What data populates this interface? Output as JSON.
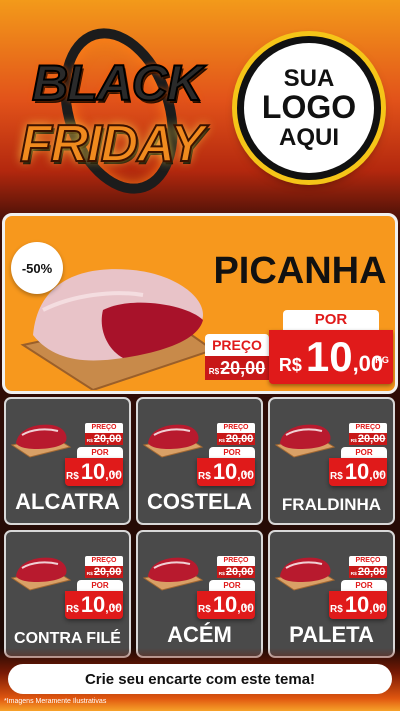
{
  "header": {
    "brand_line1": "BLACK",
    "brand_line2": "FRIDAY",
    "logo_placeholder": [
      "SUA",
      "LOGO",
      "AQUI"
    ]
  },
  "hero": {
    "discount": "-50%",
    "product": "PICANHA",
    "preco_label": "PREÇO",
    "old_currency": "R$",
    "old_price": "20,00",
    "por_label": "POR",
    "new_currency": "R$",
    "new_int": "10",
    "new_dec": ",00",
    "unit": "KG"
  },
  "products": [
    {
      "name": "ALCATRA",
      "preco_label": "PREÇO",
      "old_currency": "R$",
      "old_price": "20,00",
      "por_label": "POR",
      "new_currency": "R$",
      "new_int": "10",
      "new_dec": ",00",
      "unit": "KG"
    },
    {
      "name": "COSTELA",
      "preco_label": "PREÇO",
      "old_currency": "R$",
      "old_price": "20,00",
      "por_label": "POR",
      "new_currency": "R$",
      "new_int": "10",
      "new_dec": ",00",
      "unit": "KG"
    },
    {
      "name": "FRALDINHA",
      "preco_label": "PREÇO",
      "old_currency": "R$",
      "old_price": "20,00",
      "por_label": "POR",
      "new_currency": "R$",
      "new_int": "10",
      "new_dec": ",00",
      "unit": "KG"
    },
    {
      "name": "CONTRA FILÉ",
      "preco_label": "PREÇO",
      "old_currency": "R$",
      "old_price": "20,00",
      "por_label": "POR",
      "new_currency": "R$",
      "new_int": "10",
      "new_dec": ",00",
      "unit": "KG"
    },
    {
      "name": "ACÉM",
      "preco_label": "PREÇO",
      "old_currency": "R$",
      "old_price": "20,00",
      "por_label": "POR",
      "new_currency": "R$",
      "new_int": "10",
      "new_dec": ",00",
      "unit": "KG"
    },
    {
      "name": "PALETA",
      "preco_label": "PREÇO",
      "old_currency": "R$",
      "old_price": "20,00",
      "por_label": "POR",
      "new_currency": "R$",
      "new_int": "10",
      "new_dec": ",00",
      "unit": "KG"
    }
  ],
  "cta": {
    "label": "Crie seu encarte com este tema!"
  },
  "footnote": "*Imagens Meramente Ilustrativas",
  "colors": {
    "accent_orange": "#f7981d",
    "price_red": "#e01a1a",
    "card_bg": "#4a4a4a"
  }
}
